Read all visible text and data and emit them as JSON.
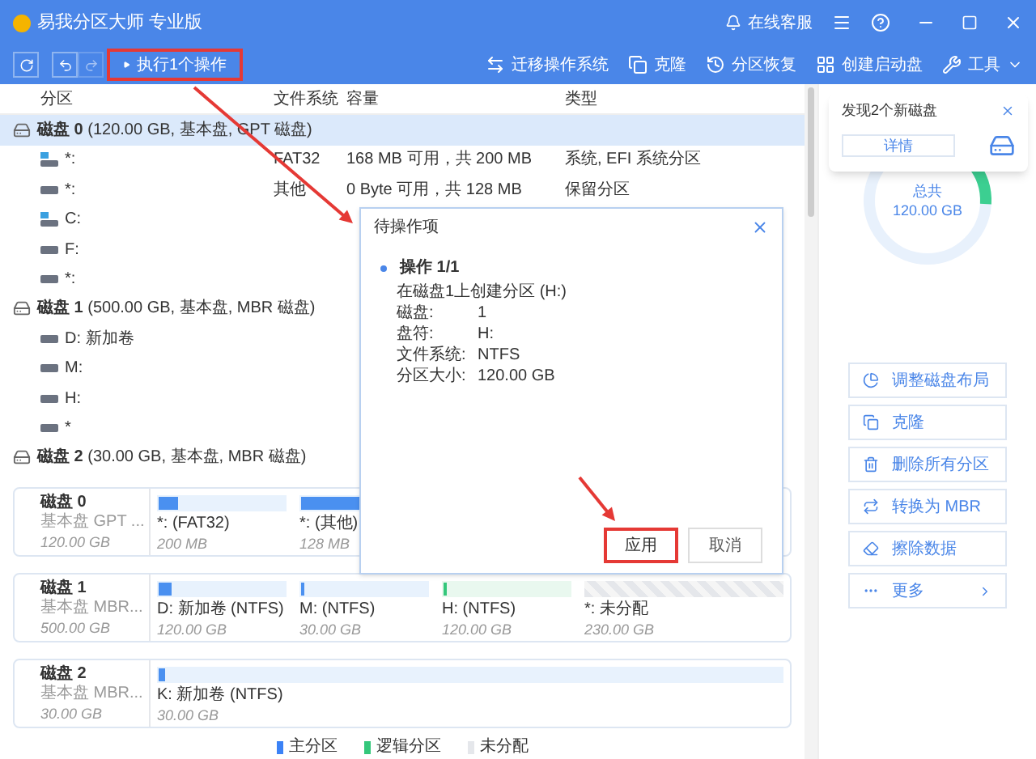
{
  "window": {
    "title": "易我分区大师 专业版",
    "online_service": "在线客服"
  },
  "toolbar": {
    "execute": {
      "label": "执行1个操作",
      "annotated": true
    },
    "actions": [
      {
        "label": "迁移操作系统",
        "kind": "migrate"
      },
      {
        "label": "克隆",
        "kind": "clone"
      },
      {
        "label": "分区恢复",
        "kind": "recover"
      },
      {
        "label": "创建启动盘",
        "kind": "boot"
      },
      {
        "label": "工具",
        "kind": "tools"
      }
    ]
  },
  "table": {
    "columns": [
      "分区",
      "文件系统",
      "容量",
      "类型"
    ],
    "disks": [
      {
        "name": "磁盘 0",
        "info": "(120.00 GB, 基本盘, GPT 磁盘)",
        "selected": true,
        "partitions": [
          {
            "name": "*:",
            "kind": "system",
            "fs": "FAT32",
            "free": "168 MB",
            "avail": "可用，共",
            "total": "200 MB",
            "type": "系统, EFI 系统分区"
          },
          {
            "name": "*:",
            "kind": "data",
            "fs": "其他",
            "free": "0 Byte",
            "avail": "可用，共",
            "total": "128 MB",
            "type": "保留分区"
          },
          {
            "name": "C:",
            "kind": "system"
          },
          {
            "name": "F:",
            "kind": "data"
          },
          {
            "name": "*:",
            "kind": "data"
          }
        ]
      },
      {
        "name": "磁盘 1",
        "info": "(500.00 GB, 基本盘, MBR 磁盘)",
        "selected": false,
        "partitions": [
          {
            "name": "D: 新加卷",
            "kind": "data"
          },
          {
            "name": "M:",
            "kind": "data"
          },
          {
            "name": "H:",
            "kind": "data"
          },
          {
            "name": "*",
            "kind": "data"
          }
        ]
      },
      {
        "name": "磁盘 2",
        "info": "(30.00 GB, 基本盘, MBR 磁盘)",
        "selected": false
      }
    ]
  },
  "disk_map": [
    {
      "name": "磁盘 0",
      "type": "基本盘 GPT ...",
      "size": "120.00 GB",
      "partitions": [
        {
          "label": "*: (FAT32)",
          "size": "200 MB",
          "kind": "primary",
          "level": 0.15
        },
        {
          "label": "*: (其他)",
          "size": "128 MB",
          "kind": "primary",
          "level": 1
        }
      ]
    },
    {
      "name": "磁盘 1",
      "type": "基本盘 MBR...",
      "size": "500.00 GB",
      "partitions": [
        {
          "label": "D: 新加卷 (NTFS)",
          "size": "120.00 GB",
          "kind": "primary",
          "level": 0.1
        },
        {
          "label": "M: (NTFS)",
          "size": "30.00 GB",
          "kind": "primary",
          "level": 0.03
        },
        {
          "label": "H: (NTFS)",
          "size": "120.00 GB",
          "kind": "logical",
          "level": 0.02
        },
        {
          "label": "*: 未分配",
          "size": "230.00 GB",
          "kind": "unallocated"
        }
      ]
    },
    {
      "name": "磁盘 2",
      "type": "基本盘 MBR...",
      "size": "30.00 GB",
      "partitions": [
        {
          "label": "K: 新加卷 (NTFS)",
          "size": "30.00 GB",
          "kind": "primary",
          "level": 0.01
        }
      ]
    }
  ],
  "legend": [
    {
      "label": "主分区",
      "color": "#3b82f6"
    },
    {
      "label": "逻辑分区",
      "color": "#34c77b"
    },
    {
      "label": "未分配",
      "color": "#e5e7eb"
    }
  ],
  "sidebar": {
    "notice": {
      "text": "发现2个新磁盘",
      "button": "详情"
    },
    "donut": {
      "label": "总共",
      "value": "120.00 GB",
      "level": 0.12
    },
    "actions": [
      {
        "label": "调整磁盘布局",
        "kind": "layout"
      },
      {
        "label": "克隆",
        "kind": "clone"
      },
      {
        "label": "删除所有分区",
        "kind": "delete"
      },
      {
        "label": "转换为 MBR",
        "kind": "convert"
      },
      {
        "label": "擦除数据",
        "kind": "wipe"
      },
      {
        "label": "更多",
        "kind": "more"
      }
    ]
  },
  "dialog": {
    "title": "待操作项",
    "heading": "操作 1/1",
    "description": "在磁盘1上创建分区 (H:)",
    "fields": [
      {
        "label": "磁盘:",
        "value": "1"
      },
      {
        "label": "盘符:",
        "value": "H:"
      },
      {
        "label": "文件系统:",
        "value": "NTFS"
      },
      {
        "label": "分区大小:",
        "value": "120.00 GB"
      }
    ],
    "buttons": [
      {
        "label": "应用",
        "kind": "primary",
        "annotated": true
      },
      {
        "label": "取消",
        "kind": "secondary",
        "annotated": false
      }
    ]
  }
}
